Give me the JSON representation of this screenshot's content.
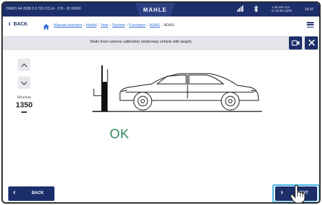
{
  "status_bar": {
    "device_info": "DEMO A4 2008 2.0 TDI CCLA - 176 - ID 80000",
    "logo": "MAHLE",
    "signal_icon": "signal-icon",
    "bluetooth_icon": "bluetooth-icon",
    "network": [
      "1.36.202.113",
      "(1.36.96.1)(IR)"
    ],
    "time": "14:37"
  },
  "nav": {
    "back_label": "BACK",
    "home_icon": "home-icon",
    "breadcrumbs": [
      "Manual selection",
      "Model",
      "Year",
      "System",
      "Functions",
      "ADAS"
    ],
    "current": "ADAS",
    "menu_icon": "menu-icon"
  },
  "title_bar": {
    "title": "Static front camera calibration (stationary vehicle with target)",
    "camera_icon": "camera-icon",
    "close_icon": "close-icon"
  },
  "main": {
    "up_icon": "chevron-up-icon",
    "down_icon": "chevron-down-icon",
    "structure_label": "Structure",
    "structure_value": "1350",
    "status_text": "OK"
  },
  "footer": {
    "back_label": "BACK",
    "next_label": "NEXT"
  },
  "colors": {
    "navy": "#1c2f6b",
    "ok_green": "#2f8a5a",
    "next_highlight": "#3db4e8",
    "title_bar_bg": "#e3e5ea"
  }
}
